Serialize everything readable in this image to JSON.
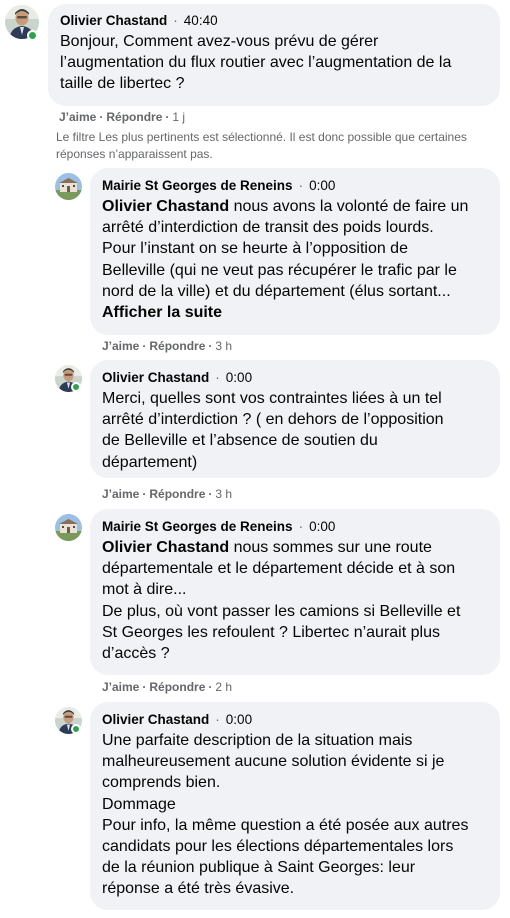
{
  "comments": [
    {
      "author": "Olivier Chastand",
      "time": "40:40",
      "lines": [
        "Bonjour, Comment avez-vous prévu de gérer",
        "l’augmentation du flux routier avec l’augmentation de la",
        "taille de libertec ?"
      ],
      "like": "J’aime",
      "reply": "Répondre",
      "age": "1 j"
    },
    {
      "author": "Mairie St Georges de Reneins",
      "time": "0:00",
      "mention": "Olivier Chastand",
      "first_rest": " nous avons la volonté de faire un",
      "lines": [
        "arrêté d’interdiction de transit des poids lourds.",
        "Pour l’instant on se heurte à l’opposition de",
        "Belleville (qui ne veut pas récupérer le trafic par le",
        "nord de la ville) et du département (élus sortant..."
      ],
      "see_more": "Afficher la suite",
      "like": "J’aime",
      "reply": "Répondre",
      "age": "3 h"
    },
    {
      "author": "Olivier Chastand",
      "time": "0:00",
      "lines": [
        "Merci, quelles sont vos contraintes liées à un tel",
        "arrêté d’interdiction ? ( en dehors de l’opposition",
        "de Belleville et l’absence de soutien du",
        "département)"
      ],
      "like": "J’aime",
      "reply": "Répondre",
      "age": "3 h"
    },
    {
      "author": "Mairie St Georges de Reneins",
      "time": "0:00",
      "mention": "Olivier Chastand",
      "first_rest": " nous sommes sur une route",
      "lines": [
        "départementale et le département décide et à son",
        "mot à dire...",
        "De plus, où vont passer les camions si Belleville et",
        "St Georges les refoulent ? Libertec n’aurait plus",
        "d’accès ?"
      ],
      "like": "J’aime",
      "reply": "Répondre",
      "age": "2 h"
    },
    {
      "author": "Olivier Chastand",
      "time": "0:00",
      "lines": [
        "Une parfaite description de la situation mais",
        "malheureusement aucune solution évidente si je",
        "comprends bien.",
        "Dommage",
        "Pour info, la même question a été posée aux autres",
        "candidats pour les élections départementales lors",
        "de la réunion publique à Saint Georges: leur",
        "réponse a été très évasive."
      ]
    }
  ],
  "filter_notice": "Le filtre Les plus pertinents est sélectionné. Il est donc possible que certaines réponses n’apparaissent pas.",
  "separator_dot": "·",
  "icons": {
    "olivier_avatar": "person-avatar-icon",
    "mairie_avatar": "town-hall-avatar-icon",
    "online": "online-status-dot"
  },
  "colors": {
    "bubble": "#f0f2f5",
    "meta": "#65676b",
    "online": "#31a24c"
  }
}
